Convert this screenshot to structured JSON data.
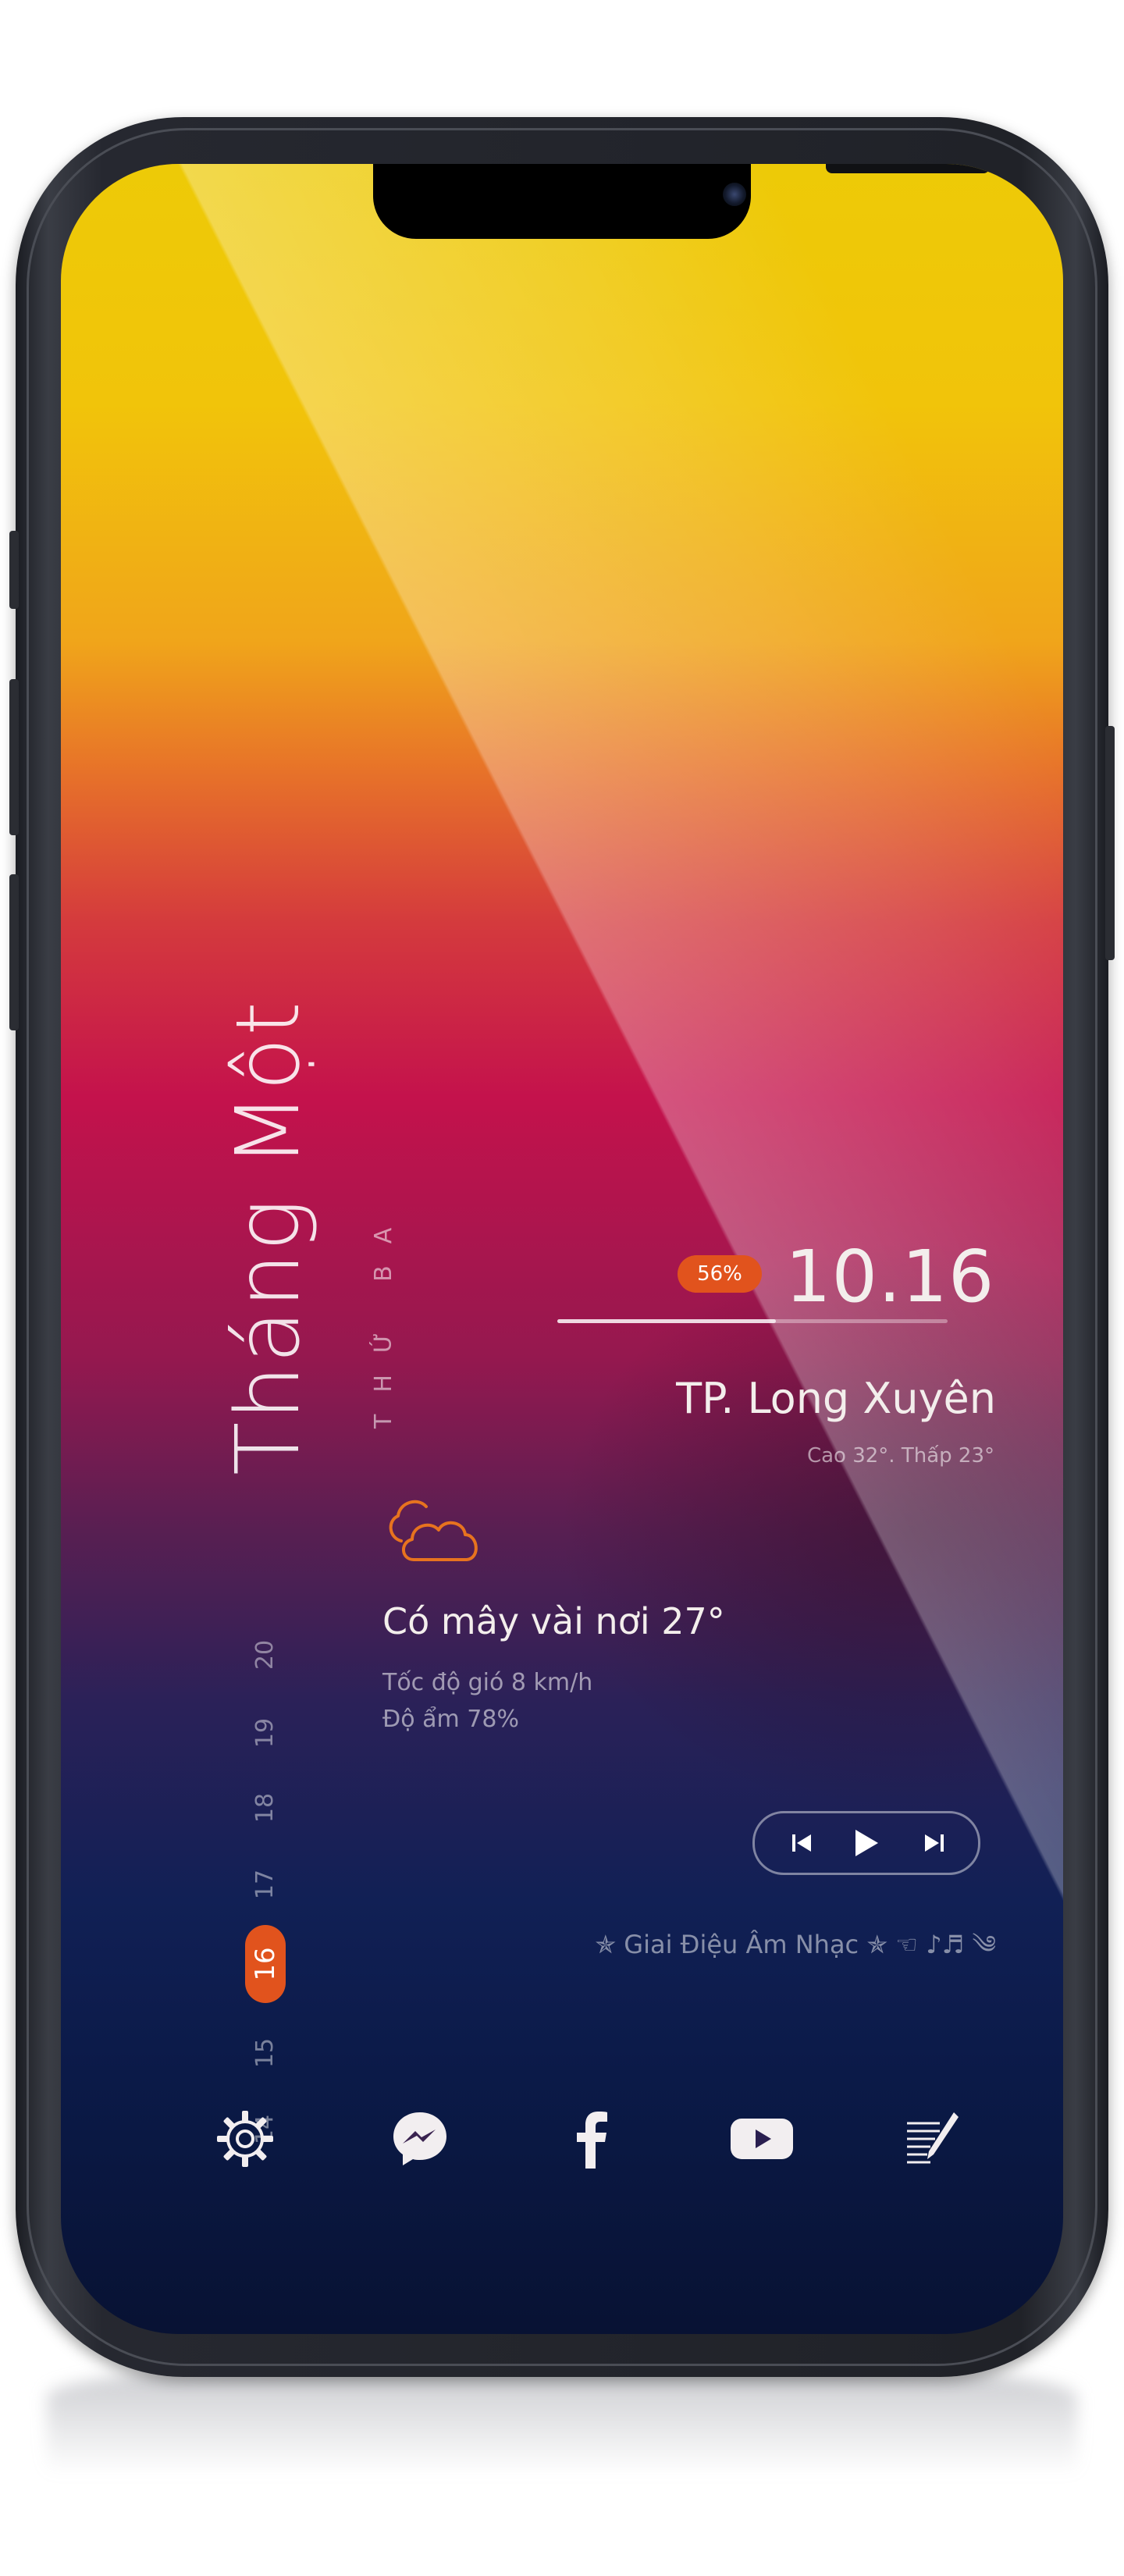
{
  "calendar": {
    "month": "Tháng Một",
    "weekday": "THỨ BA",
    "days": [
      "20",
      "19",
      "18",
      "17",
      "16",
      "15",
      "14"
    ],
    "active_day": "16"
  },
  "status": {
    "battery": "56%",
    "battery_level": 0.56,
    "time": "10.16"
  },
  "weather": {
    "city": "TP. Long Xuyên",
    "high_low": "Cao 32°. Thấp 23°",
    "icon": "cloud-icon",
    "condition": "Có mây vài nơi 27°",
    "wind": "Tốc độ gió 8 km/h",
    "humidity": "Độ ẩm 78%"
  },
  "music": {
    "title": "✯ Giai Điệu Âm Nhạc ✯ ☜ ♪♬ ༄",
    "controls": [
      "previous-icon",
      "play-icon",
      "next-icon"
    ]
  },
  "dock": {
    "items": [
      "settings-icon",
      "messenger-icon",
      "facebook-icon",
      "youtube-icon",
      "notes-icon"
    ]
  },
  "colors": {
    "accent": "#e1531d",
    "weather_icon": "#e7731f",
    "text": "#f3eeec"
  }
}
